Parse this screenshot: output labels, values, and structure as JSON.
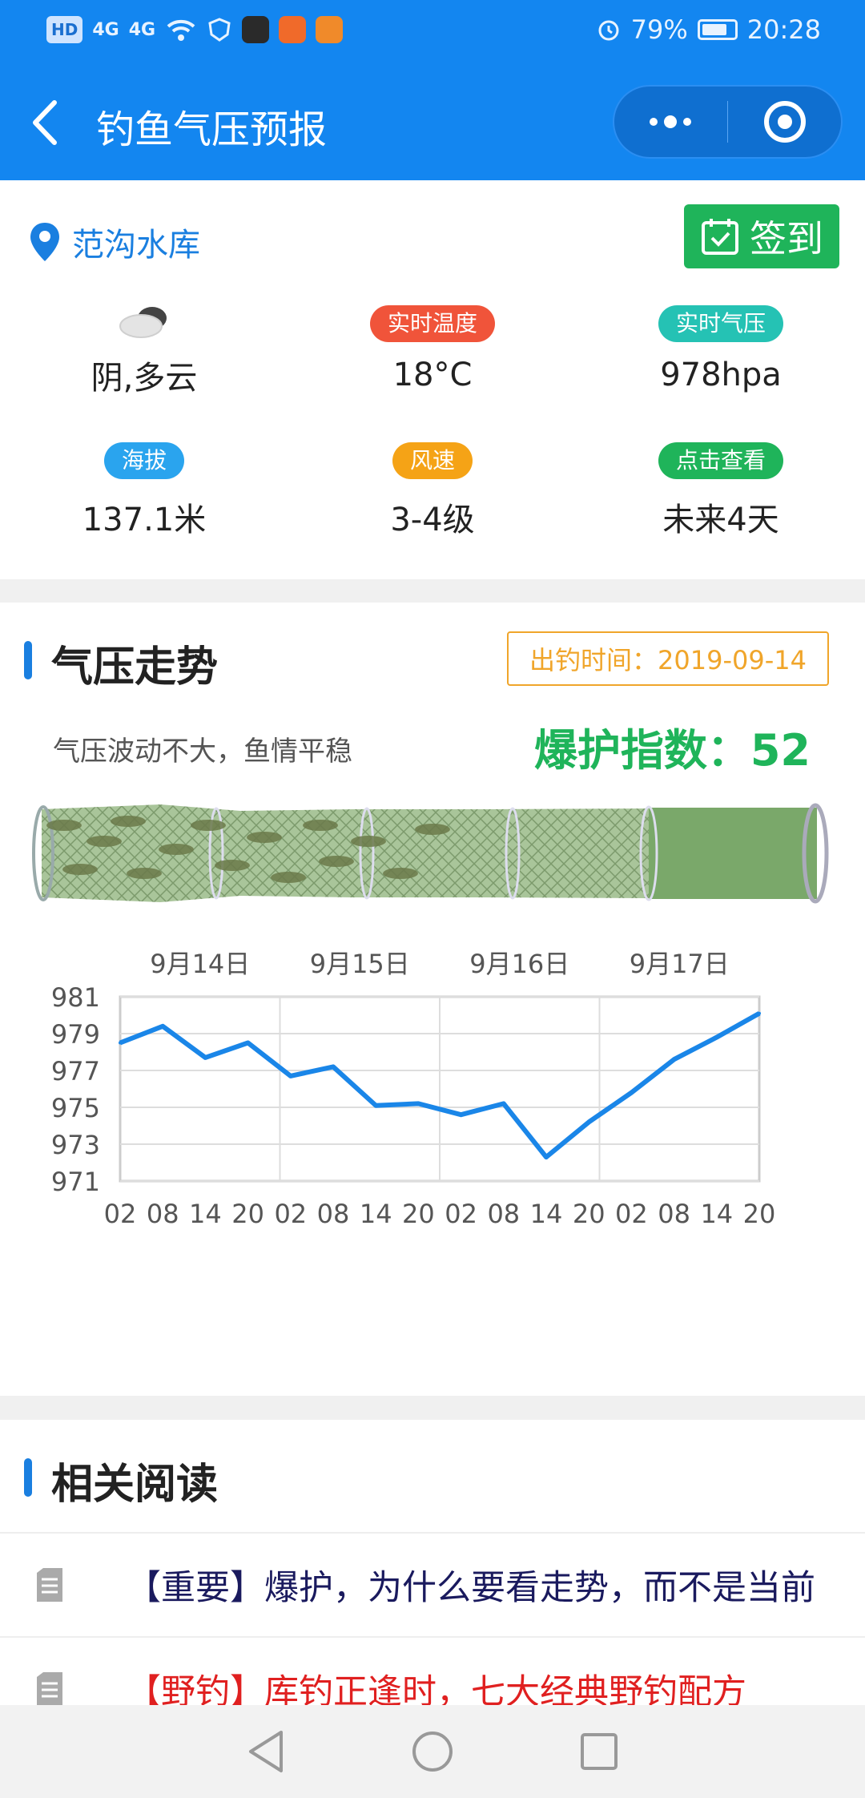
{
  "status_bar": {
    "hd_label": "HD",
    "signal1": "4G",
    "signal2": "4G",
    "battery_percent": "79%",
    "battery_level": 0.79,
    "time": "20:28"
  },
  "nav": {
    "title": "钓鱼气压预报"
  },
  "location": {
    "name": "范沟水库",
    "checkin_label": "签到"
  },
  "weather": {
    "condition": "阴,多云",
    "temp_tag": "实时温度",
    "temp_value": "18°C",
    "pressure_tag": "实时气压",
    "pressure_value": "978hpa",
    "altitude_tag": "海拔",
    "altitude_value": "137.1米",
    "wind_tag": "风速",
    "wind_value": "3-4级",
    "forecast_tag": "点击查看",
    "forecast_value": "未来4天"
  },
  "colors": {
    "primary": "#1386f0",
    "green": "#1fb45a",
    "red_tag": "#f0543a",
    "teal_tag": "#25c2b4",
    "blue_tag": "#2aa4ee",
    "orange_tag": "#f5a316",
    "chart_line": "#1a86e8"
  },
  "trend": {
    "title": "气压走势",
    "fishing_time": "出钓时间：2019-09-14",
    "description": "气压波动不大，鱼情平稳",
    "index_label": "爆护指数：52",
    "index_value": 52
  },
  "chart_data": {
    "type": "line",
    "days": [
      "9月14日",
      "9月15日",
      "9月16日",
      "9月17日"
    ],
    "categories": [
      "02",
      "08",
      "14",
      "20",
      "02",
      "08",
      "14",
      "20",
      "02",
      "08",
      "14",
      "20",
      "02",
      "08",
      "14",
      "20"
    ],
    "values": [
      978.5,
      979.4,
      977.7,
      978.5,
      976.7,
      977.2,
      975.1,
      975.2,
      974.6,
      975.2,
      972.3,
      974.2,
      975.8,
      977.6,
      978.8,
      980.1
    ],
    "yticks": [
      "981",
      "979",
      "977",
      "975",
      "973",
      "971"
    ],
    "ylim": [
      971,
      982
    ],
    "grid": true
  },
  "reading": {
    "title": "相关阅读",
    "articles": [
      {
        "text": "【重要】爆护，为什么要看走势，而不是当前",
        "color": "#1a1a5e"
      },
      {
        "text": "【野钓】库钓正逢时，七大经典野钓配方",
        "color": "#e02020"
      }
    ]
  }
}
